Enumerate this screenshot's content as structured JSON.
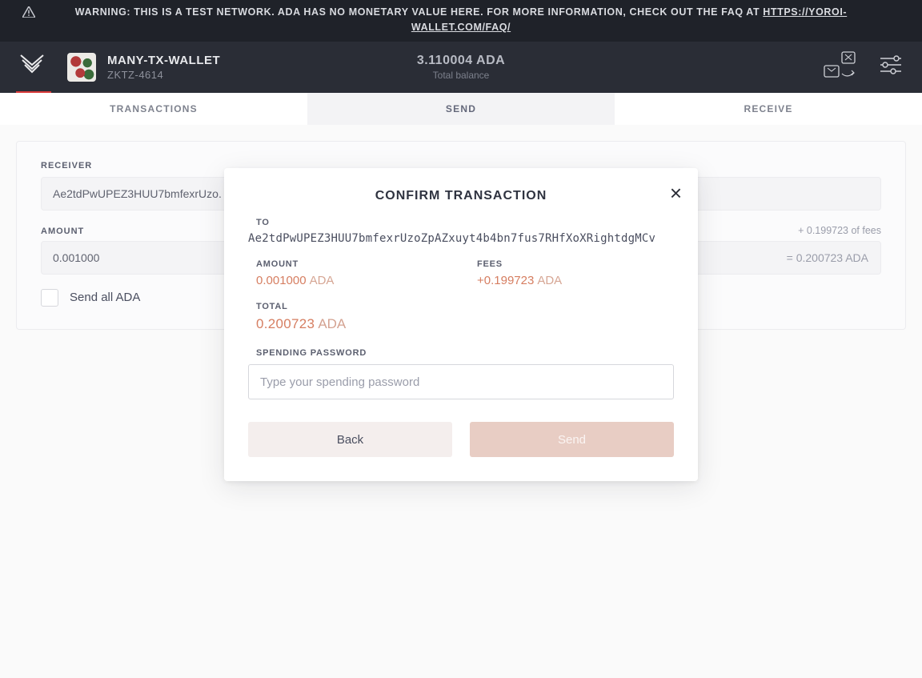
{
  "warning": {
    "text": "WARNING: THIS IS A TEST NETWORK. ADA HAS NO MONETARY VALUE HERE. FOR MORE INFORMATION, CHECK OUT THE FAQ AT ",
    "link_text": "HTTPS://YOROI-WALLET.COM/FAQ/"
  },
  "header": {
    "wallet_name": "MANY-TX-WALLET",
    "wallet_plate": "ZKTZ-4614",
    "balance_value": "3.110004 ADA",
    "balance_label": "Total balance"
  },
  "tabs": {
    "transactions": "TRANSACTIONS",
    "send": "SEND",
    "receive": "RECEIVE"
  },
  "send_form": {
    "receiver_label": "RECEIVER",
    "receiver_value": "Ae2tdPwUPEZ3HUU7bmfexrUzo.",
    "amount_label": "AMOUNT",
    "amount_value": "0.001000",
    "fees_hint": "+ 0.199723 of fees",
    "eq_hint": "= 0.200723 ADA",
    "sendall_label": "Send all ADA"
  },
  "modal": {
    "title": "CONFIRM TRANSACTION",
    "to_label": "TO",
    "to_address": "Ae2tdPwUPEZ3HUU7bmfexrUzoZpAZxuyt4b4bn7fus7RHfXoXRightdgMCv",
    "amount_label": "AMOUNT",
    "amount_value": "0.001000",
    "amount_unit": "ADA",
    "fees_label": "FEES",
    "fees_value": "+0.199723",
    "fees_unit": "ADA",
    "total_label": "TOTAL",
    "total_value": "0.200723",
    "total_unit": "ADA",
    "pw_label": "SPENDING PASSWORD",
    "pw_placeholder": "Type your spending password",
    "back_label": "Back",
    "send_label": "Send"
  }
}
